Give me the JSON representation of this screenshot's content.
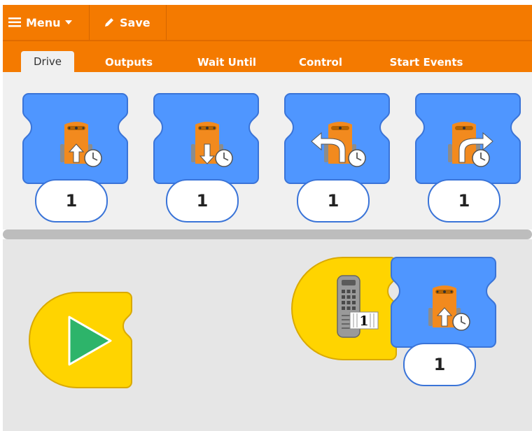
{
  "toolbar": {
    "menu_label": "Menu",
    "save_label": "Save"
  },
  "tabs": [
    {
      "label": "Drive",
      "active": true
    },
    {
      "label": "Outputs",
      "active": false
    },
    {
      "label": "Wait Until",
      "active": false
    },
    {
      "label": "Control",
      "active": false
    },
    {
      "label": "Start Events",
      "active": false
    }
  ],
  "palette": {
    "blocks": [
      {
        "icon": "drive-forward-icon",
        "value": "1"
      },
      {
        "icon": "drive-backward-icon",
        "value": "1"
      },
      {
        "icon": "turn-left-icon",
        "value": "1"
      },
      {
        "icon": "turn-right-icon",
        "value": "1"
      }
    ]
  },
  "canvas": {
    "start_block": {
      "icon": "play-icon"
    },
    "remote_block": {
      "icon": "remote-control-icon",
      "value": "1"
    },
    "drive_block": {
      "icon": "drive-forward-icon",
      "value": "1"
    }
  },
  "colors": {
    "orange": "#f47a00",
    "blue": "#4f96ff",
    "blue_border": "#3a74d8",
    "yellow": "#ffd400",
    "green": "#2db46a"
  }
}
